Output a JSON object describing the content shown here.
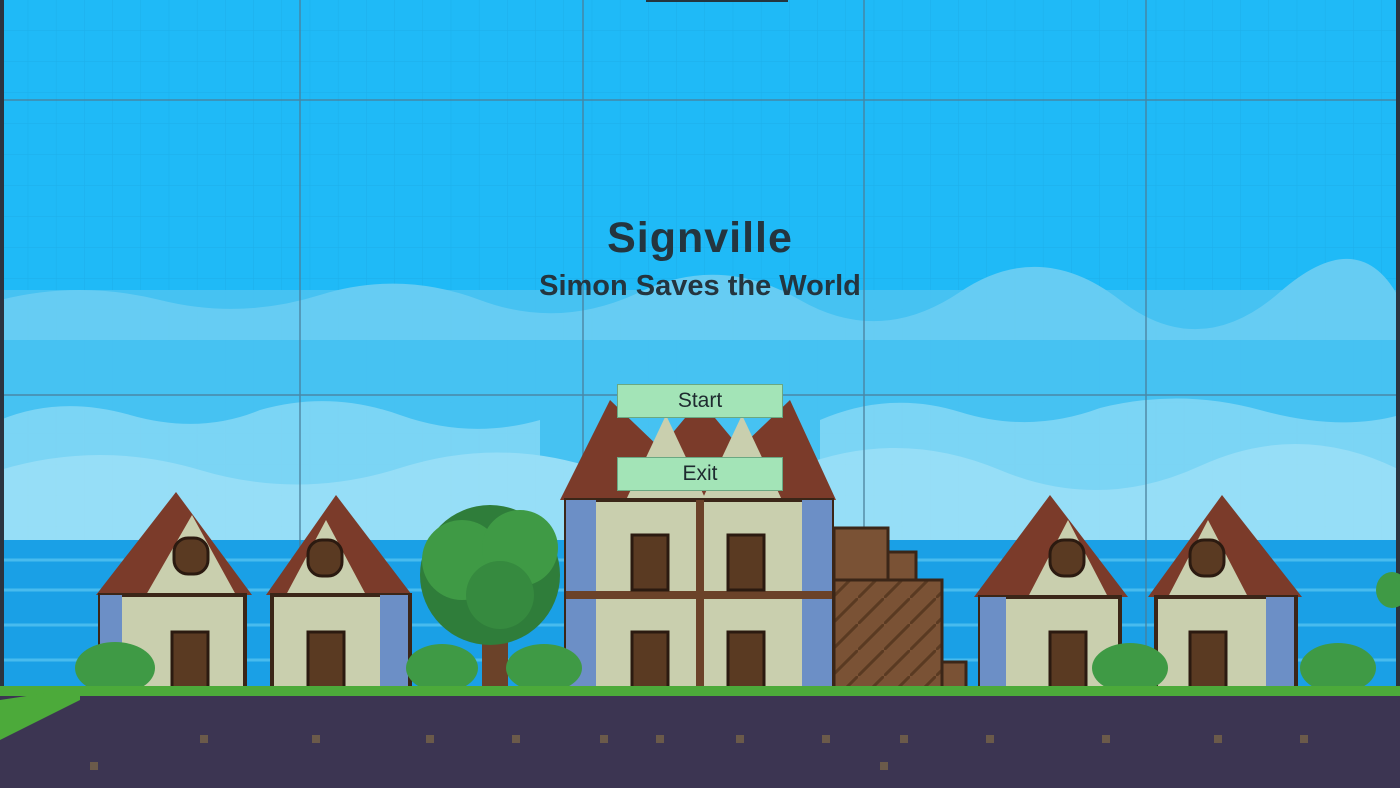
{
  "game": {
    "title": "Signville",
    "subtitle": "Simon Saves the World"
  },
  "menu": {
    "start_label": "Start",
    "exit_label": "Exit"
  },
  "colors": {
    "sky": "#1fbaf7",
    "button_bg": "#a3e4b7",
    "title_text": "#24353f",
    "ground": "#3c3552",
    "grass": "#4caa3a"
  }
}
